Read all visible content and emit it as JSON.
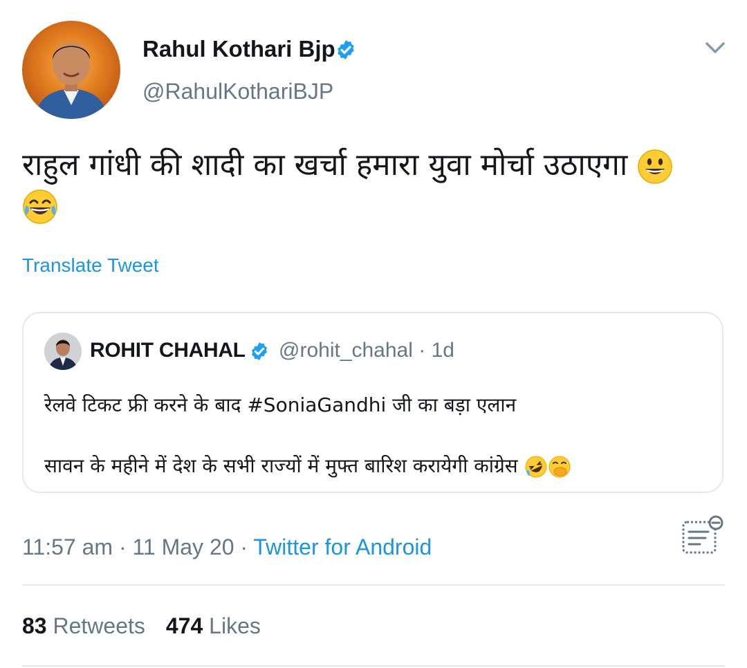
{
  "tweet": {
    "author": {
      "display_name": "Rahul Kothari Bjp",
      "handle": "@RahulKothariBJP",
      "verified": true
    },
    "text": "राहुल गांधी की शादी का खर्चा हमारा युवा मोर्चा उठाएगा",
    "emojis": [
      "grinning-face",
      "face-with-tears-of-joy"
    ],
    "translate_label": "Translate Tweet",
    "quoted": {
      "display_name": "ROHIT CHAHAL",
      "handle": "@rohit_chahal",
      "separator": "·",
      "age": "1d",
      "verified": true,
      "line1": "रेलवे टिकट फ्री करने के बाद #SoniaGandhi जी  का बड़ा एलान",
      "line2": "सावन के महीने में देश के सभी राज्यों में मुफ्त बारिश करायेगी कांग्रेस",
      "emojis": [
        "rolling-on-floor-laughing",
        "face-with-hand-over-mouth"
      ]
    },
    "time": "11:57 am",
    "date": "11 May 20",
    "dot": "·",
    "source": "Twitter for Android",
    "retweets": {
      "count": "83",
      "label": "Retweets"
    },
    "likes": {
      "count": "474",
      "label": "Likes"
    }
  },
  "colors": {
    "link_blue": "#1b95e0",
    "verified_blue": "#1da1f2",
    "secondary_text": "#657786",
    "border": "#e1e8ed"
  }
}
